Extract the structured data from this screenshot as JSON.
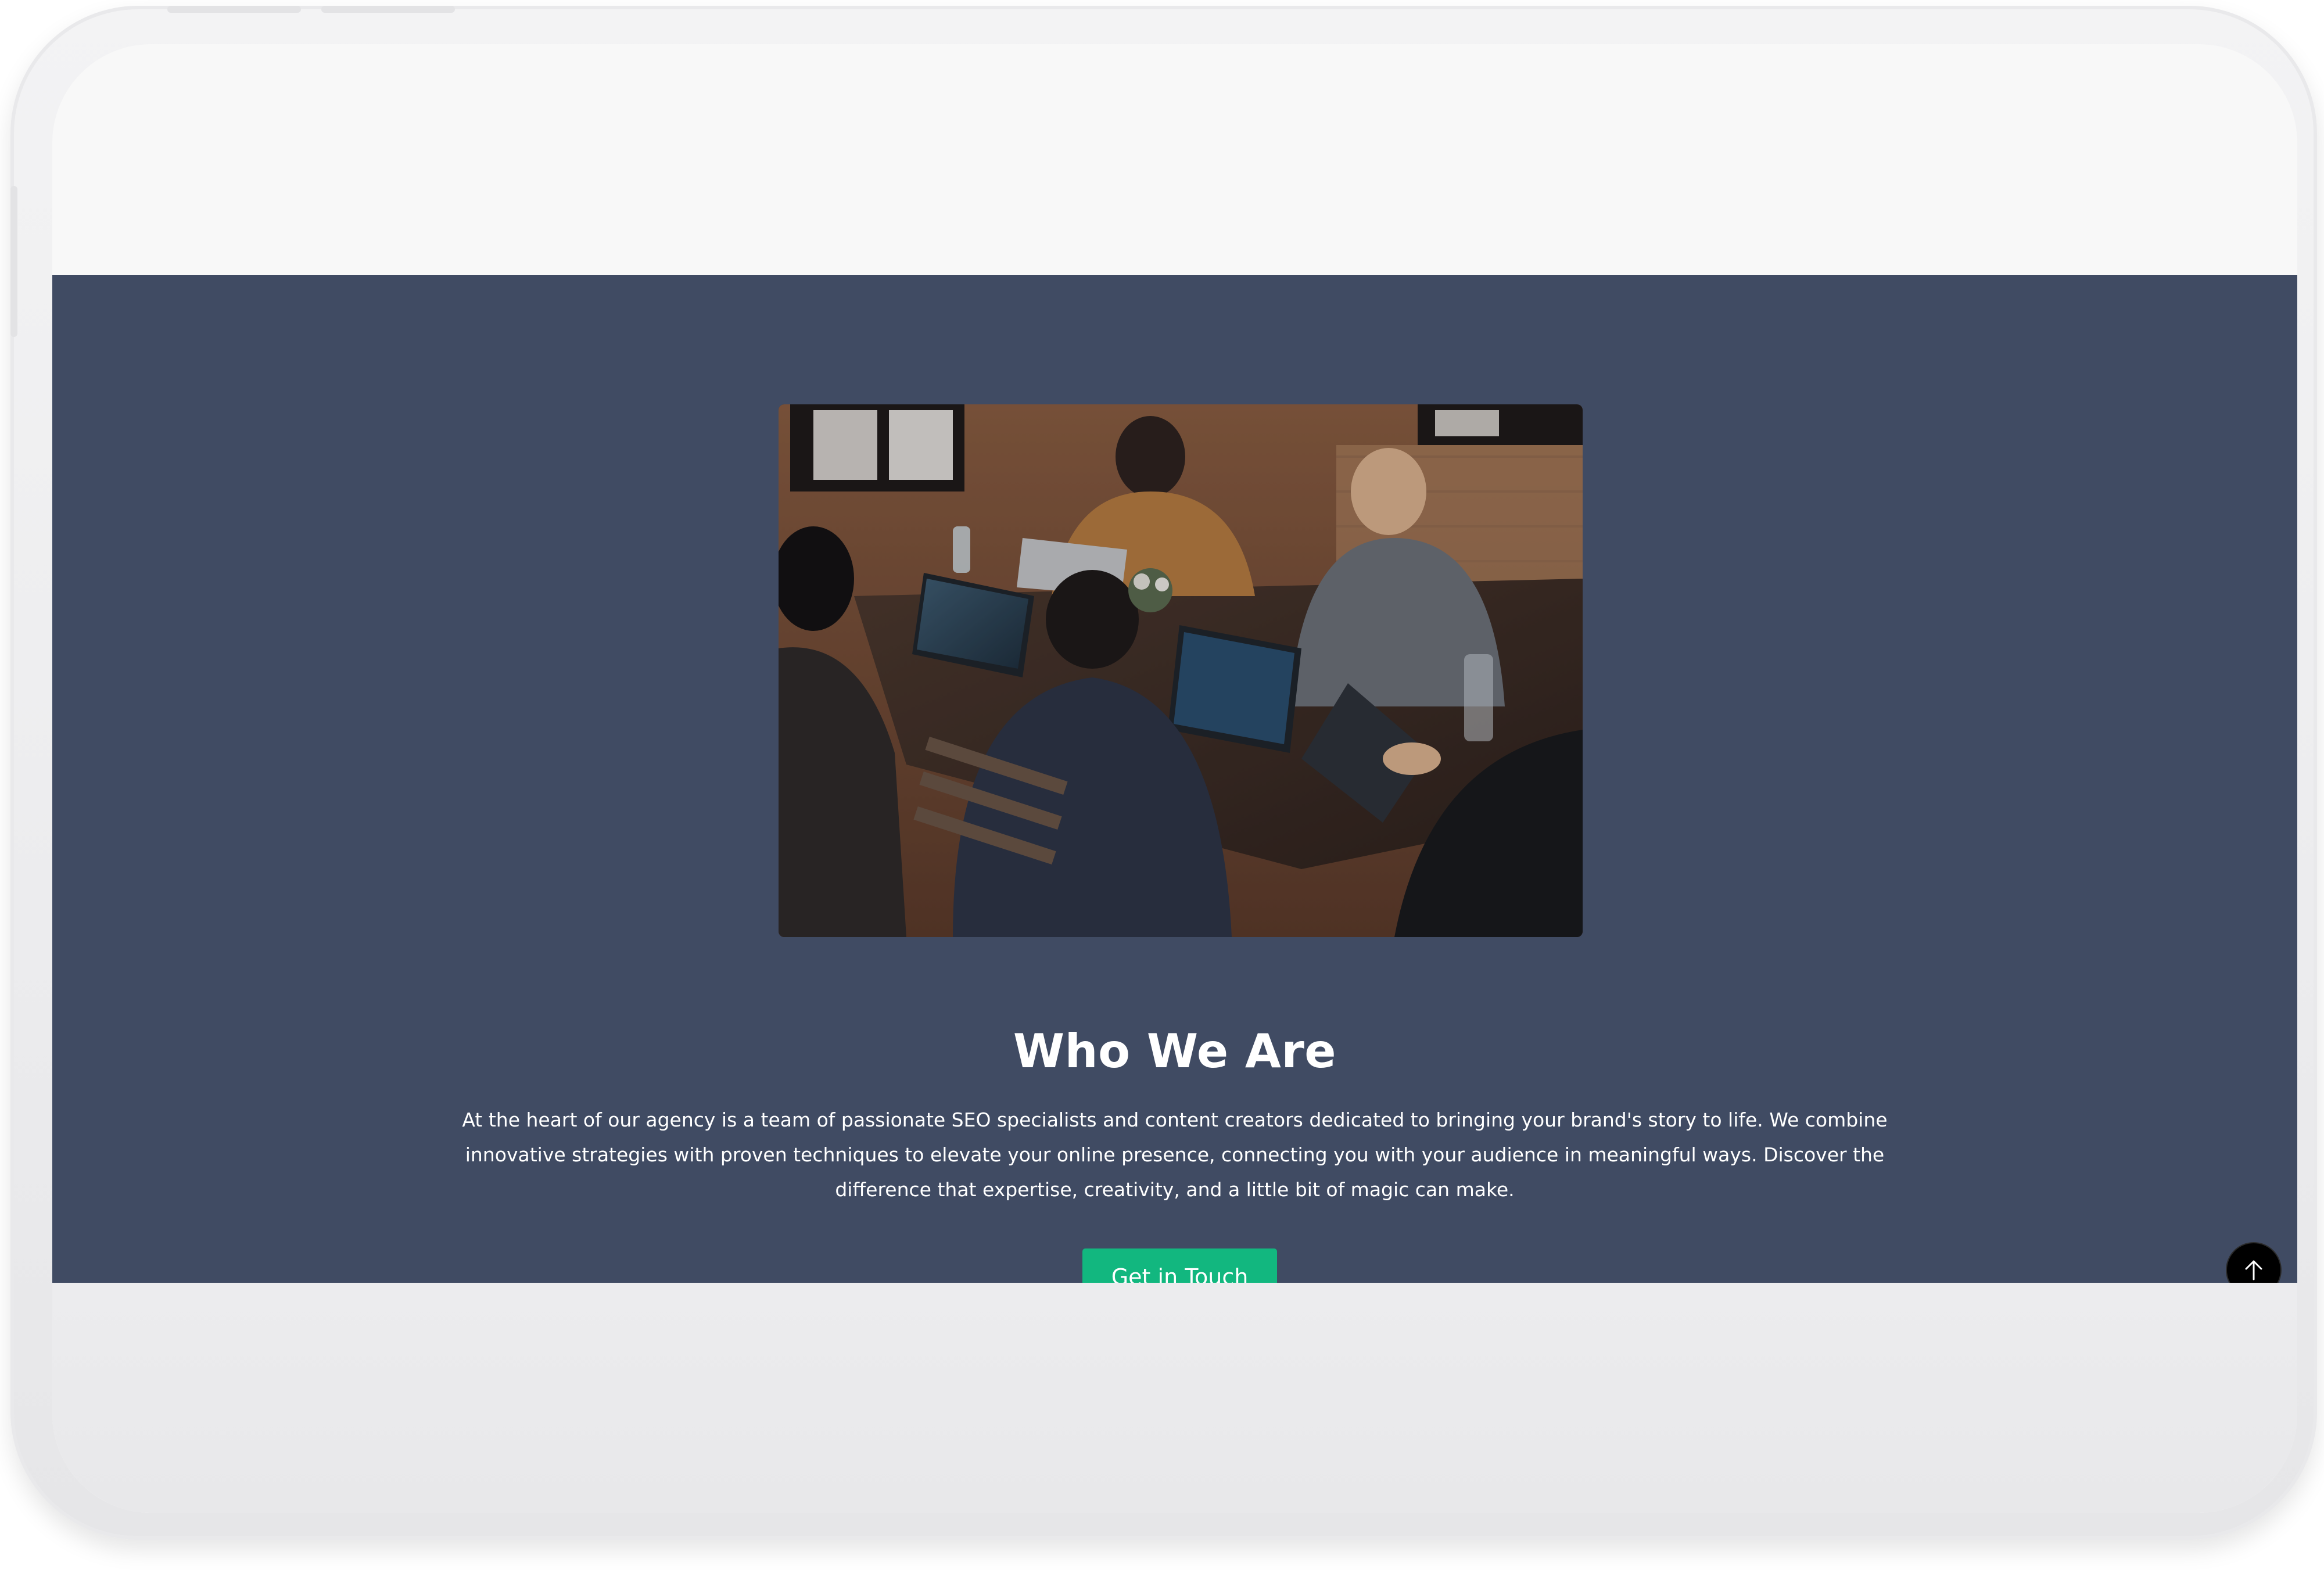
{
  "about": {
    "image_alt": "Team working on laptops around a wooden table",
    "title": "Who We Are",
    "description": "At the heart of our agency is a team of passionate SEO specialists and content creators dedicated to bringing your brand's story to life. We combine innovative strategies with proven techniques to elevate your online presence, connecting you with your audience in meaningful ways. Discover the difference that expertise, creativity, and a little bit of magic can make.",
    "cta_label": "Get in Touch"
  },
  "scroll_top": {
    "icon": "arrow-up-icon"
  },
  "colors": {
    "section_bg": "#404b63",
    "cta_bg": "#12b77f",
    "text": "#ffffff",
    "page_bg": "#f8f8f8"
  }
}
